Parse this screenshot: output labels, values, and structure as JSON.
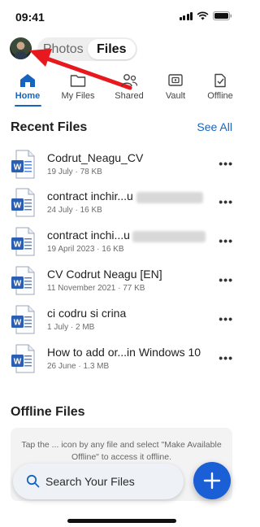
{
  "status_bar": {
    "time": "09:41"
  },
  "header": {
    "segments": [
      {
        "label": "Photos",
        "active": false
      },
      {
        "label": "Files",
        "active": true
      }
    ]
  },
  "tabs": [
    {
      "label": "Home",
      "icon": "home-icon",
      "active": true
    },
    {
      "label": "My Files",
      "icon": "folder-icon",
      "active": false
    },
    {
      "label": "Shared",
      "icon": "people-icon",
      "active": false
    },
    {
      "label": "Vault",
      "icon": "vault-icon",
      "active": false
    },
    {
      "label": "Offline",
      "icon": "offline-doc-icon",
      "active": false
    }
  ],
  "recent": {
    "title": "Recent Files",
    "see_all": "See All",
    "files": [
      {
        "name": "Codrut_Neagu_CV",
        "meta": "19 July · 78 KB"
      },
      {
        "name": "contract inchir...u",
        "meta": "24 July · 16 KB"
      },
      {
        "name": "contract inchi...u",
        "meta": "19 April 2023 · 16 KB"
      },
      {
        "name": "CV Codrut Neagu [EN]",
        "meta": "11 November 2021 · 77 KB"
      },
      {
        "name": "ci codru si crina",
        "meta": "1 July · 2 MB"
      },
      {
        "name": "How to add or...in Windows 10",
        "meta": "26 June · 1.3 MB"
      }
    ],
    "more_label": "•••"
  },
  "offline": {
    "title": "Offline Files",
    "hint": "Tap the ... icon by any file and select \"Make Available Offline\" to access it offline."
  },
  "search": {
    "label": "Search Your Files"
  },
  "colors": {
    "accent": "#1565c0",
    "fab": "#1a5fd6",
    "word_blue": "#2b5fb4",
    "arrow": "#e8191e"
  }
}
